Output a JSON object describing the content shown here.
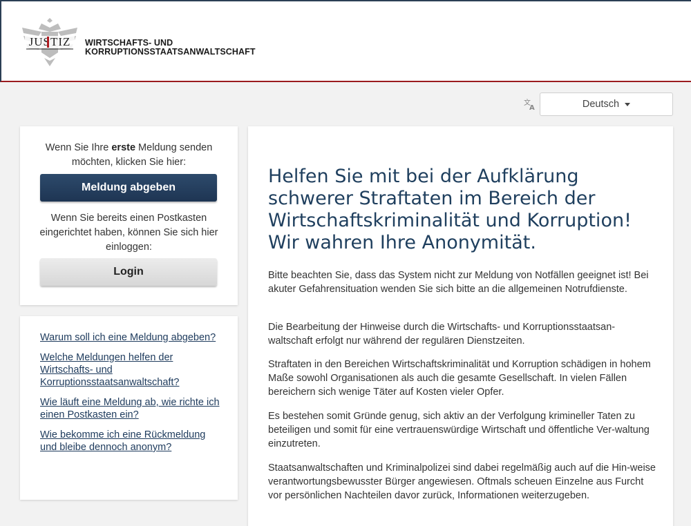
{
  "header": {
    "logo_text": "JUSTIZ",
    "org_line1": "WIRTSCHAFTS- UND",
    "org_line2": "KORRUPTIONSSTAATSANWALTSCHAFT"
  },
  "language": {
    "icon": "translate-icon",
    "selected": "Deutsch"
  },
  "login_card": {
    "first_pre": "Wenn Sie Ihre ",
    "first_bold": "erste",
    "first_post": " Meldung senden möchten, klicken Sie hier:",
    "report_button": "Meldung abgeben",
    "existing_text": "Wenn Sie bereits einen Postkasten eingerichtet haben, können Sie sich hier einloggen:",
    "login_button": "Login"
  },
  "faq_links": [
    "Warum soll ich eine Meldung abgeben?",
    "Welche Meldungen helfen der Wirtschafts- und Korruptionsstaatsanwaltschaft?",
    "Wie läuft eine Meldung ab, wie richte ich einen Postkasten ein?",
    "Wie bekomme ich eine Rückmeldung und bleibe dennoch anonym?"
  ],
  "main": {
    "headline": "Helfen Sie mit bei der Aufklärung schwerer Straftaten im Bereich der Wirtschaftskriminalität und Korruption! Wir wahren Ihre Anonymität.",
    "paragraphs": [
      "Bitte beachten Sie, dass das System nicht zur Meldung von Notfällen geeignet ist! Bei akuter Gefahrensituation wenden Sie sich bitte an die allgemeinen Notrufdienste.",
      "Die Bearbeitung der Hinweise durch die Wirtschafts- und Korruptionsstaatsan-waltschaft erfolgt nur während der regulären Dienstzeiten.",
      "Straftaten in den Bereichen Wirtschaftskriminalität und Korruption schädigen in hohem Maße sowohl Organisationen als auch die gesamte Gesellschaft. In vielen Fällen bereichern sich wenige Täter auf Kosten vieler Opfer.",
      "Es bestehen somit Gründe genug, sich aktiv an der Verfolgung krimineller Taten zu beteiligen und somit für eine vertrauenswürdige Wirtschaft und öffentliche Ver-waltung einzutreten.",
      "Staatsanwaltschaften und Kriminalpolizei sind dabei regelmäßig auch auf die Hin-weise verantwortungsbewusster Bürger angewiesen. Oftmals scheuen Einzelne aus Furcht vor persönlichen Nachteilen davor zurück, Informationen weiterzugeben."
    ]
  },
  "colors": {
    "header_rule": "#9b1b1f",
    "primary_button": "#1e3553",
    "headline": "#1f3f5e",
    "link": "#1d3a5c"
  }
}
